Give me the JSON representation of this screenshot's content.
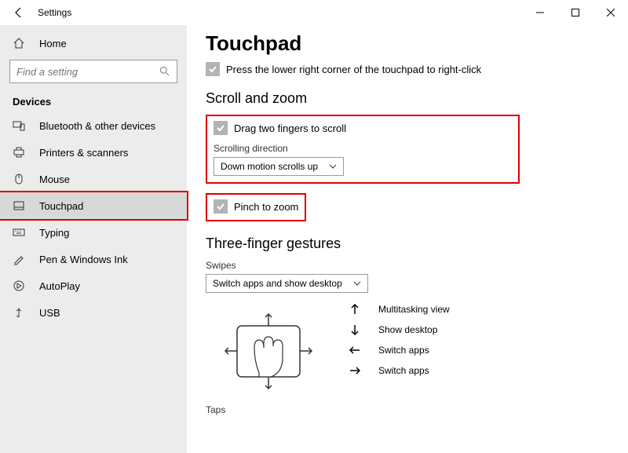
{
  "app": {
    "title": "Settings"
  },
  "search": {
    "placeholder": "Find a setting"
  },
  "sidebar": {
    "home": "Home",
    "category": "Devices",
    "items": [
      {
        "label": "Bluetooth & other devices"
      },
      {
        "label": "Printers & scanners"
      },
      {
        "label": "Mouse"
      },
      {
        "label": "Touchpad"
      },
      {
        "label": "Typing"
      },
      {
        "label": "Pen & Windows Ink"
      },
      {
        "label": "AutoPlay"
      },
      {
        "label": "USB"
      }
    ]
  },
  "page": {
    "title": "Touchpad",
    "chk_corner": "Press the lower right corner of the touchpad to right-click",
    "h_scroll": "Scroll and zoom",
    "chk_drag": "Drag two fingers to scroll",
    "lbl_scrolldir": "Scrolling direction",
    "dd_scroll": "Down motion scrolls up",
    "chk_pinch": "Pinch to zoom",
    "h_three": "Three-finger gestures",
    "lbl_swipes": "Swipes",
    "dd_swipes": "Switch apps and show desktop",
    "legend": {
      "up": "Multitasking view",
      "down": "Show desktop",
      "left": "Switch apps",
      "right": "Switch apps"
    },
    "h_taps": "Taps"
  }
}
